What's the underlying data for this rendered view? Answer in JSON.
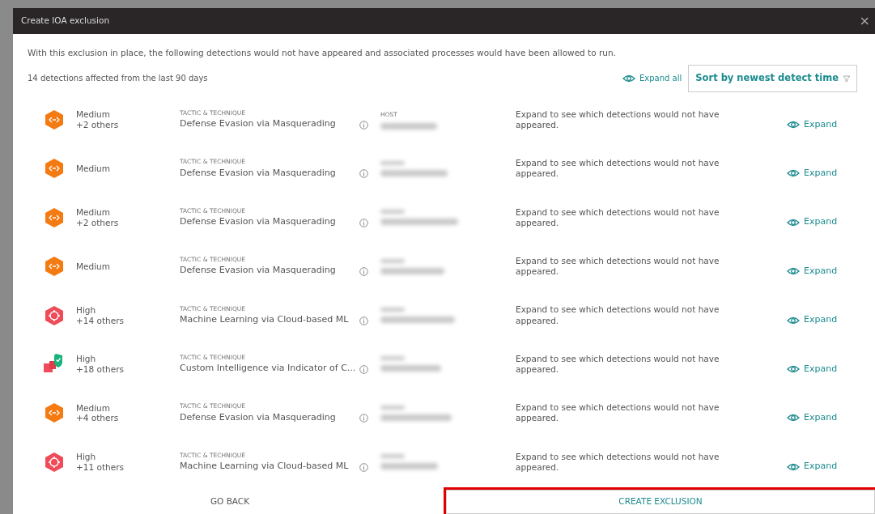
{
  "window": {
    "title": "Create IOA exclusion",
    "close": "×"
  },
  "intro": "With this exclusion in place, the following detections would not have appeared and associated processes would have been allowed to run.",
  "summary": "14 detections affected from the last 90 days",
  "expand_all": "Expand all",
  "sort": {
    "label": "Sort by newest detect time"
  },
  "rows": [
    {
      "kind": "masquerade",
      "severity": "Medium",
      "others": "+2 others",
      "tactic_label": "TACTIC & TECHNIQUE",
      "tactic": "Defense Evasion via Masquerading",
      "host_label": "HOST",
      "description": "Expand to see which detections would not have appeared.",
      "action": "Expand"
    },
    {
      "kind": "masquerade",
      "severity": "Medium",
      "tactic_label": "TACTIC & TECHNIQUE",
      "tactic": "Defense Evasion via Masquerading",
      "description": "Expand to see which detections would not have appeared.",
      "action": "Expand"
    },
    {
      "kind": "masquerade",
      "severity": "Medium",
      "others": "+2 others",
      "tactic_label": "TACTIC & TECHNIQUE",
      "tactic": "Defense Evasion via Masquerading",
      "description": "Expand to see which detections would not have appeared.",
      "action": "Expand"
    },
    {
      "kind": "masquerade",
      "severity": "Medium",
      "tactic_label": "TACTIC & TECHNIQUE",
      "tactic": "Defense Evasion via Masquerading",
      "description": "Expand to see which detections would not have appeared.",
      "action": "Expand"
    },
    {
      "kind": "ml",
      "severity": "High",
      "others": "+14 others",
      "tactic_label": "TACTIC & TECHNIQUE",
      "tactic": "Machine Learning via Cloud-based ML",
      "description": "Expand to see which detections would not have appeared.",
      "action": "Expand"
    },
    {
      "kind": "custom",
      "severity": "High",
      "others": "+18 others",
      "tactic_label": "TACTIC & TECHNIQUE",
      "tactic": "Custom Intelligence via Indicator of C...",
      "description": "Expand to see which detections would not have appeared.",
      "action": "Expand"
    },
    {
      "kind": "masquerade",
      "severity": "Medium",
      "others": "+4 others",
      "tactic_label": "TACTIC & TECHNIQUE",
      "tactic": "Defense Evasion via Masquerading",
      "description": "Expand to see which detections would not have appeared.",
      "action": "Expand"
    },
    {
      "kind": "ml",
      "severity": "High",
      "others": "+11 others",
      "tactic_label": "TACTIC & TECHNIQUE",
      "tactic": "Machine Learning via Cloud-based ML",
      "description": "Expand to see which detections would not have appeared.",
      "action": "Expand"
    }
  ],
  "footer": {
    "back": "GO BACK",
    "create": {
      "label": "CREATE EXCLUSION",
      "highlighted": true
    }
  }
}
